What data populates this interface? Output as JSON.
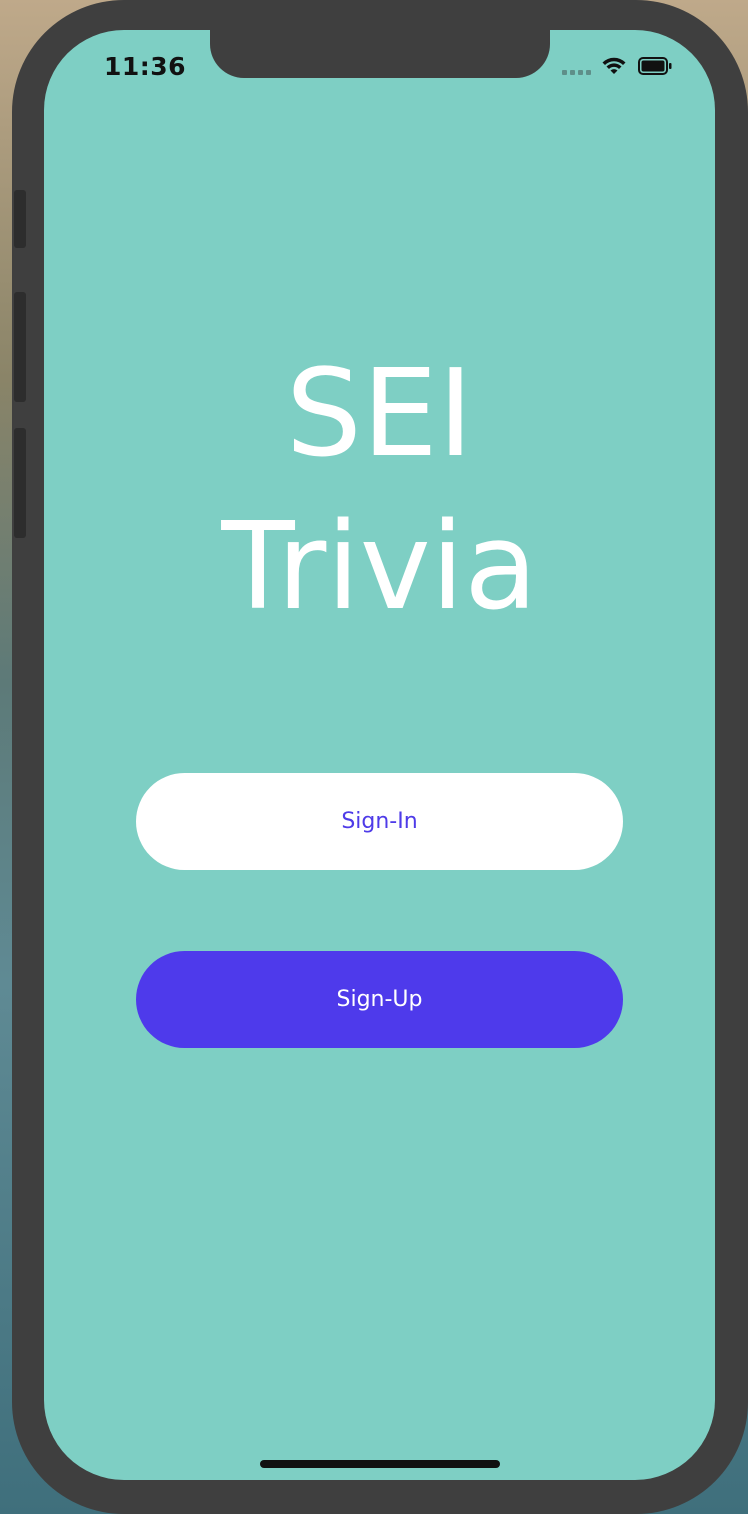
{
  "status_bar": {
    "time": "11:36"
  },
  "app": {
    "title_line1": "SEI",
    "title_line2": "Trivia"
  },
  "buttons": {
    "sign_in": "Sign-In",
    "sign_up": "Sign-Up"
  },
  "colors": {
    "screen_bg": "#7ecfc4",
    "accent": "#4e3aeb",
    "title_text": "#ffffff"
  },
  "icons": {
    "signal": "cellular-signal-icon",
    "wifi": "wifi-icon",
    "battery": "battery-icon"
  }
}
